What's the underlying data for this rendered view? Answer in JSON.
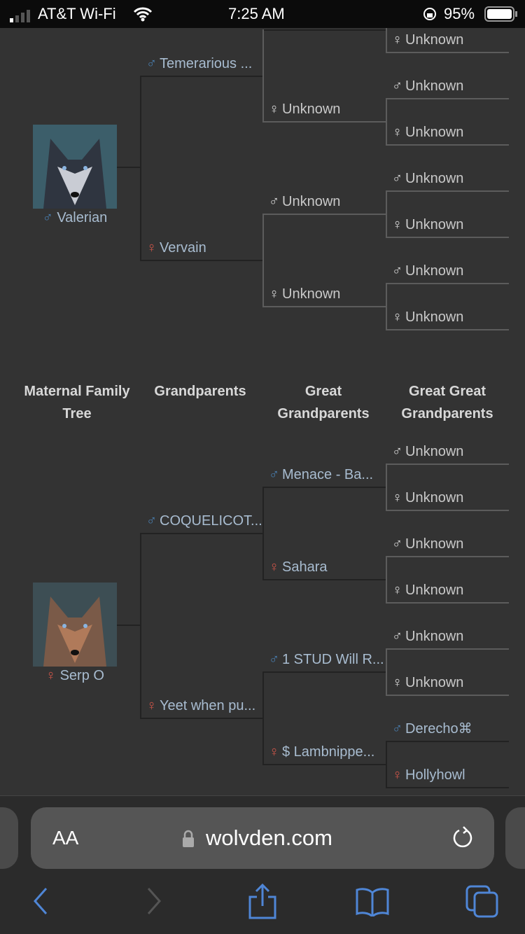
{
  "status_bar": {
    "carrier": "AT&T Wi-Fi",
    "time": "7:25 AM",
    "battery": "95%"
  },
  "colors": {
    "male": "#4a80b3",
    "female": "#d0564a",
    "known_text": "#a8bcd0",
    "unknown_text": "#c9c9c9",
    "unknown_icon": "#dddddd"
  },
  "paternal": {
    "subject": {
      "name": "Valerian",
      "sex": "male"
    },
    "parents": [
      {
        "name": "Temerarious ...",
        "sex": "male",
        "known": true
      },
      {
        "name": "Vervain",
        "sex": "female",
        "known": true
      }
    ],
    "grandparents": [
      null,
      {
        "name": "Unknown",
        "sex": "female",
        "known": false
      },
      {
        "name": "Unknown",
        "sex": "male",
        "known": false
      },
      {
        "name": "Unknown",
        "sex": "female",
        "known": false
      }
    ],
    "great_grandparents": [
      null,
      {
        "name": "Unknown",
        "sex": "female",
        "known": false
      },
      {
        "name": "Unknown",
        "sex": "male",
        "known": false
      },
      {
        "name": "Unknown",
        "sex": "female",
        "known": false
      },
      {
        "name": "Unknown",
        "sex": "male",
        "known": false
      },
      {
        "name": "Unknown",
        "sex": "female",
        "known": false
      },
      {
        "name": "Unknown",
        "sex": "male",
        "known": false
      },
      {
        "name": "Unknown",
        "sex": "female",
        "known": false
      }
    ]
  },
  "headers": {
    "tree": "Maternal Family Tree",
    "grandparents": "Grandparents",
    "great": "Great Grandparents",
    "great_great": "Great Great Grandparents"
  },
  "maternal": {
    "subject": {
      "name": "Serp O",
      "sex": "female"
    },
    "parents": [
      {
        "name": "COQUELICOT...",
        "sex": "male",
        "known": true
      },
      {
        "name": "Yeet when pu...",
        "sex": "female",
        "known": true
      }
    ],
    "grandparents": [
      {
        "name": "Menace - Ba...",
        "sex": "male",
        "known": true
      },
      {
        "name": "Sahara",
        "sex": "female",
        "known": true
      },
      {
        "name": "1 STUD Will R...",
        "sex": "male",
        "known": true
      },
      {
        "name": "$ Lambnippe...",
        "sex": "female",
        "known": true
      }
    ],
    "great_grandparents": [
      {
        "name": "Unknown",
        "sex": "male",
        "known": false
      },
      {
        "name": "Unknown",
        "sex": "female",
        "known": false
      },
      {
        "name": "Unknown",
        "sex": "male",
        "known": false
      },
      {
        "name": "Unknown",
        "sex": "female",
        "known": false
      },
      {
        "name": "Unknown",
        "sex": "male",
        "known": false
      },
      {
        "name": "Unknown",
        "sex": "female",
        "known": false
      },
      {
        "name": "Derecho⌘",
        "sex": "male",
        "known": true
      },
      {
        "name": "Hollyhowl",
        "sex": "female",
        "known": true
      }
    ]
  },
  "browser": {
    "text_size": "AA",
    "url": "wolvden.com"
  }
}
